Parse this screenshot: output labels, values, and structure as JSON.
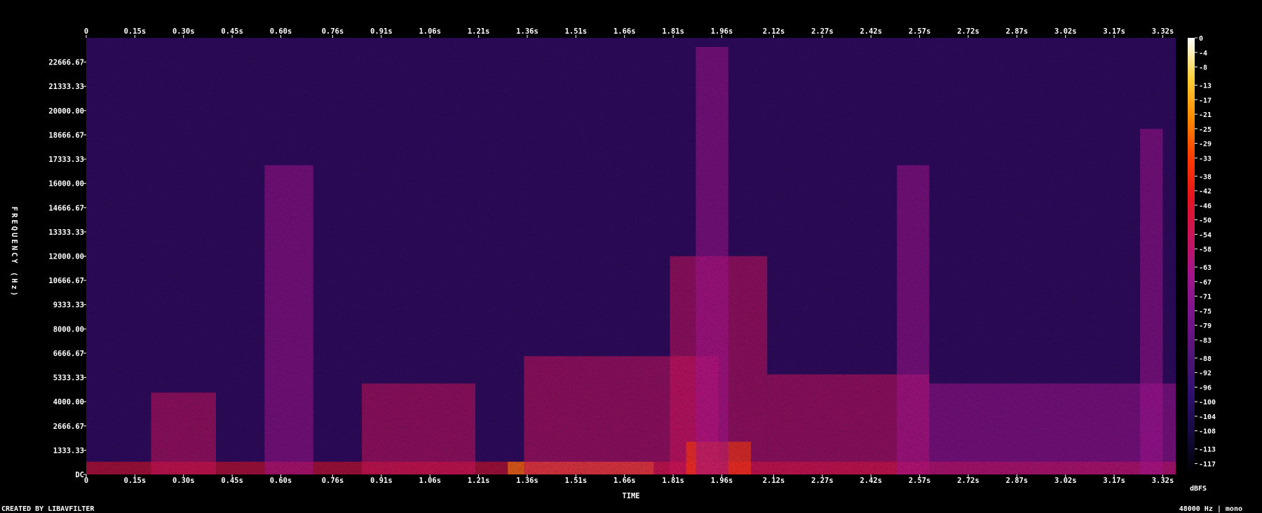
{
  "chart_data": {
    "type": "heatmap",
    "x_ticks": [
      "0",
      "0.15s",
      "0.30s",
      "0.45s",
      "0.60s",
      "0.76s",
      "0.91s",
      "1.06s",
      "1.21s",
      "1.36s",
      "1.51s",
      "1.66s",
      "1.81s",
      "1.96s",
      "2.12s",
      "2.27s",
      "2.42s",
      "2.57s",
      "2.72s",
      "2.87s",
      "3.02s",
      "3.17s",
      "3.32s"
    ],
    "x_tick_values": [
      0,
      0.15,
      0.3,
      0.45,
      0.6,
      0.76,
      0.91,
      1.06,
      1.21,
      1.36,
      1.51,
      1.66,
      1.81,
      1.96,
      2.12,
      2.27,
      2.42,
      2.57,
      2.72,
      2.87,
      3.02,
      3.17,
      3.32
    ],
    "x_range": [
      0,
      3.36
    ],
    "y_ticks": [
      "DC",
      "1333.33",
      "2666.67",
      "4000.00",
      "5333.33",
      "6666.67",
      "8000.00",
      "9333.33",
      "10666.67",
      "12000.00",
      "13333.33",
      "14666.67",
      "16000.00",
      "17333.33",
      "18666.67",
      "20000.00",
      "21333.33",
      "22666.67"
    ],
    "y_tick_values": [
      0,
      1333.33,
      2666.67,
      4000,
      5333.33,
      6666.67,
      8000,
      9333.33,
      10666.67,
      12000,
      13333.33,
      14666.67,
      16000,
      17333.33,
      18666.67,
      20000,
      21333.33,
      22666.67
    ],
    "y_range": [
      0,
      24000
    ],
    "xlabel": "TIME",
    "ylabel": "FREQUENCY (Hz)",
    "colorbar": {
      "ticks": [
        "0",
        "-4",
        "-8",
        "-13",
        "-17",
        "-21",
        "-25",
        "-29",
        "-33",
        "-38",
        "-42",
        "-46",
        "-50",
        "-54",
        "-58",
        "-63",
        "-67",
        "-71",
        "-75",
        "-79",
        "-83",
        "-88",
        "-92",
        "-96",
        "-100",
        "-104",
        "-108",
        "-113",
        "-117"
      ],
      "range": [
        -120,
        0
      ],
      "unit": "dBFS"
    },
    "colormap": [
      "#000000",
      "#140a3c",
      "#2d0f6e",
      "#501478",
      "#78148c",
      "#a0148c",
      "#c8145a",
      "#e6141e",
      "#ff3c00",
      "#ff8c00",
      "#ffd23c",
      "#ffffff"
    ],
    "energy_events": [
      {
        "t_start": 0.0,
        "t_end": 3.36,
        "f_max": 700,
        "level_db": -45
      },
      {
        "t_start": 0.2,
        "t_end": 0.4,
        "f_max": 4500,
        "level_db": -60
      },
      {
        "t_start": 0.55,
        "t_end": 0.7,
        "f_max": 17000,
        "level_db": -64
      },
      {
        "t_start": 0.85,
        "t_end": 1.2,
        "f_max": 5000,
        "level_db": -60
      },
      {
        "t_start": 1.3,
        "t_end": 1.75,
        "f_max": 700,
        "level_db": -25
      },
      {
        "t_start": 1.35,
        "t_end": 1.95,
        "f_max": 6500,
        "level_db": -50
      },
      {
        "t_start": 1.8,
        "t_end": 2.1,
        "f_max": 12000,
        "level_db": -52
      },
      {
        "t_start": 1.85,
        "t_end": 2.05,
        "f_max": 1800,
        "level_db": -35
      },
      {
        "t_start": 1.88,
        "t_end": 1.98,
        "f_max": 23500,
        "level_db": -66
      },
      {
        "t_start": 2.1,
        "t_end": 2.6,
        "f_max": 5500,
        "level_db": -58
      },
      {
        "t_start": 2.5,
        "t_end": 2.6,
        "f_max": 17000,
        "level_db": -65
      },
      {
        "t_start": 2.6,
        "t_end": 3.36,
        "f_max": 5000,
        "level_db": -62
      },
      {
        "t_start": 3.25,
        "t_end": 3.32,
        "f_max": 19000,
        "level_db": -68
      }
    ]
  },
  "footer": {
    "created_by": "CREATED BY LIBAVFILTER",
    "audio_info": "48000 Hz | mono"
  }
}
